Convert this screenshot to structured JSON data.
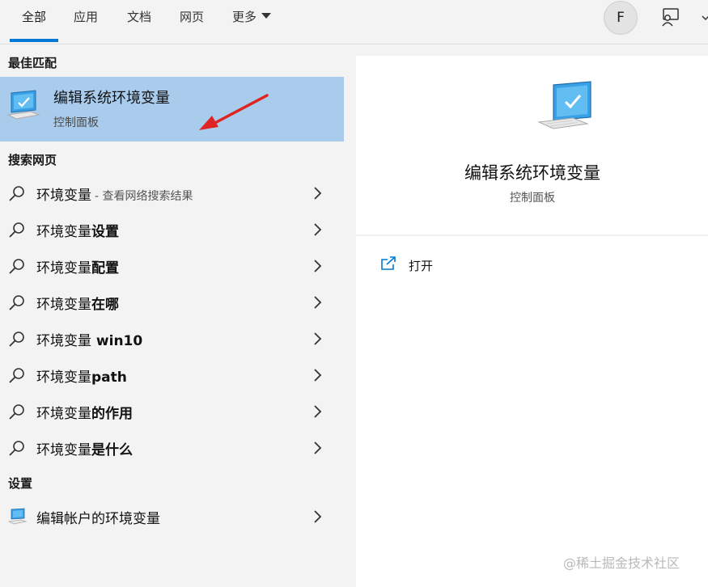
{
  "tabs": [
    {
      "label": "全部",
      "active": true
    },
    {
      "label": "应用"
    },
    {
      "label": "文档"
    },
    {
      "label": "网页"
    },
    {
      "label": "更多"
    }
  ],
  "user_initial": "F",
  "accent_color": "#0078d4",
  "selected_bg": "#a9ccec",
  "sections": {
    "best_match": "最佳匹配",
    "web_search": "搜索网页",
    "settings": "设置"
  },
  "best_match": {
    "title": "编辑系统环境变量",
    "subtitle": "控制面板",
    "icon": "monitor-check-icon"
  },
  "web_results": [
    {
      "base": "环境变量",
      "suffix": "",
      "hint": "- 查看网络搜索结果"
    },
    {
      "base": "环境变量",
      "suffix": "设置",
      "hint": ""
    },
    {
      "base": "环境变量",
      "suffix": "配置",
      "hint": ""
    },
    {
      "base": "环境变量",
      "suffix": "在哪",
      "hint": ""
    },
    {
      "base": "环境变量",
      "suffix": " win10",
      "hint": ""
    },
    {
      "base": "环境变量",
      "suffix": "path",
      "hint": ""
    },
    {
      "base": "环境变量",
      "suffix": "的作用",
      "hint": ""
    },
    {
      "base": "环境变量",
      "suffix": "是什么",
      "hint": ""
    }
  ],
  "settings_results": [
    {
      "label": "编辑帐户的环境变量"
    }
  ],
  "detail": {
    "title": "编辑系统环境变量",
    "subtitle": "控制面板",
    "action_open": "打开"
  },
  "watermark": "@稀土掘金技术社区"
}
